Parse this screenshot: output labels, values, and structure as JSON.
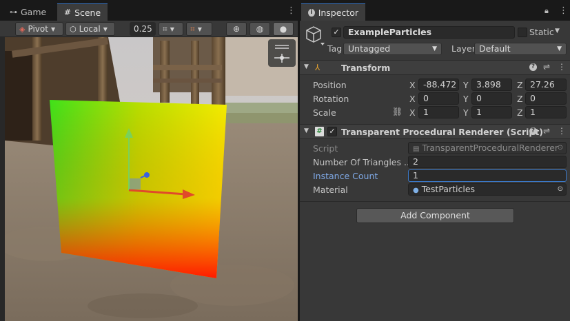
{
  "scene_tabs": [
    {
      "label": "Game"
    },
    {
      "label": "Scene"
    }
  ],
  "toolbar": {
    "pivot": "Pivot",
    "local": "Local",
    "snap": "0.25"
  },
  "inspector": {
    "tab": "Inspector",
    "object": {
      "name": "ExampleParticles",
      "static_label": "Static",
      "tag_label": "Tag",
      "tag": "Untagged",
      "layer_label": "Layer",
      "layer": "Default"
    },
    "transform": {
      "title": "Transform",
      "position": {
        "label": "Position",
        "x": "-88.472",
        "y": "3.898",
        "z": "27.26"
      },
      "rotation": {
        "label": "Rotation",
        "x": "0",
        "y": "0",
        "z": "0"
      },
      "scale": {
        "label": "Scale",
        "x": "1",
        "y": "1",
        "z": "1"
      }
    },
    "axes": {
      "x": "X",
      "y": "Y",
      "z": "Z"
    },
    "script_component": {
      "title": "Transparent Procedural Renderer (Script)",
      "script_label": "Script",
      "script_value": "TransparentProceduralRenderer",
      "triangles_label": "Number Of Triangles ...",
      "triangles_value": "2",
      "instance_label": "Instance Count",
      "instance_value": "1",
      "material_label": "Material",
      "material_value": "TestParticles"
    },
    "add_component": "Add Component"
  },
  "colors": {
    "accent": "#3a78c8",
    "instance_label": "#7fa9e6"
  }
}
